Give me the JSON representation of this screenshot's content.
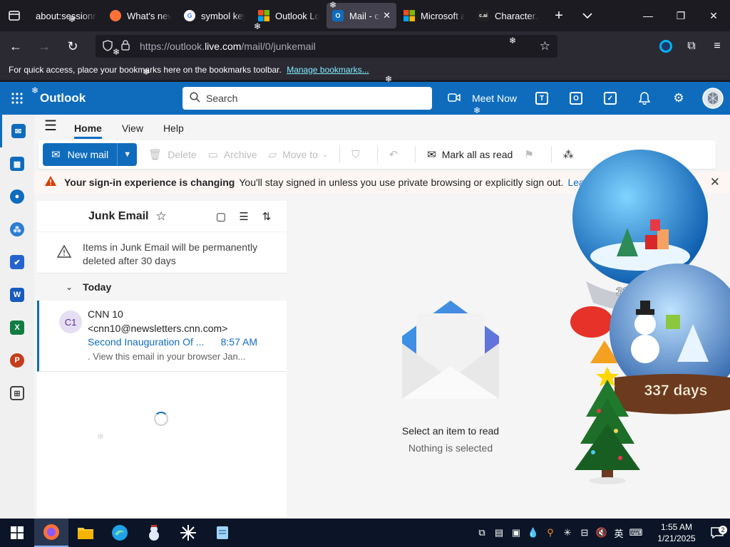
{
  "browser": {
    "tabs": [
      {
        "title": "about:sessionre",
        "icon": "page-icon"
      },
      {
        "title": "What's new",
        "icon": "firefox-icon"
      },
      {
        "title": "symbol key",
        "icon": "google-icon"
      },
      {
        "title": "Outlook Lo",
        "icon": "microsoft-icon"
      },
      {
        "title": "Mail - cc",
        "icon": "outlook-icon",
        "active": true
      },
      {
        "title": "Microsoft a",
        "icon": "microsoft-icon"
      },
      {
        "title": "Character.A",
        "icon": "character-ai-icon"
      }
    ],
    "url_prefix": "https://outlook.",
    "url_domain": "live.com",
    "url_path": "/mail/0/junkemail",
    "bookmarks_text": "For quick access, place your bookmarks here on the bookmarks toolbar.",
    "bookmarks_link": "Manage bookmarks..."
  },
  "outlook": {
    "brand": "Outlook",
    "search_placeholder": "Search",
    "meet_now": "Meet Now",
    "ribbon_tabs": [
      "Home",
      "View",
      "Help"
    ],
    "commands": {
      "new_mail": "New mail",
      "delete": "Delete",
      "archive": "Archive",
      "move_to": "Move to",
      "mark_all_read": "Mark all as read"
    },
    "banner": {
      "bold": "Your sign-in experience is changing",
      "text": "You'll stay signed in unless you use private browsing or explicitly sign out.",
      "link": "Learn m"
    },
    "folder": {
      "title": "Junk Email",
      "notice": "Items in Junk Email will be permanently deleted after 30 days",
      "group": "Today"
    },
    "messages": [
      {
        "initials": "C1",
        "sender": "CNN 10",
        "email": "<cnn10@newsletters.cnn.com>",
        "subject": "Second Inauguration Of ...",
        "time": "8:57 AM",
        "preview": ". View this email in your browser Jan..."
      }
    ],
    "reading": {
      "title": "Select an item to read",
      "subtitle": "Nothing is selected"
    }
  },
  "decorations": {
    "globe_top_label": "337 days",
    "globe_bottom_label": "337 days"
  },
  "taskbar": {
    "time": "1:55 AM",
    "date": "1/21/2025",
    "ime": "英",
    "notifications": "2"
  },
  "colors": {
    "accent": "#0f6cbd",
    "browser_bg": "#1c1b22",
    "warning": "#d83b01"
  }
}
